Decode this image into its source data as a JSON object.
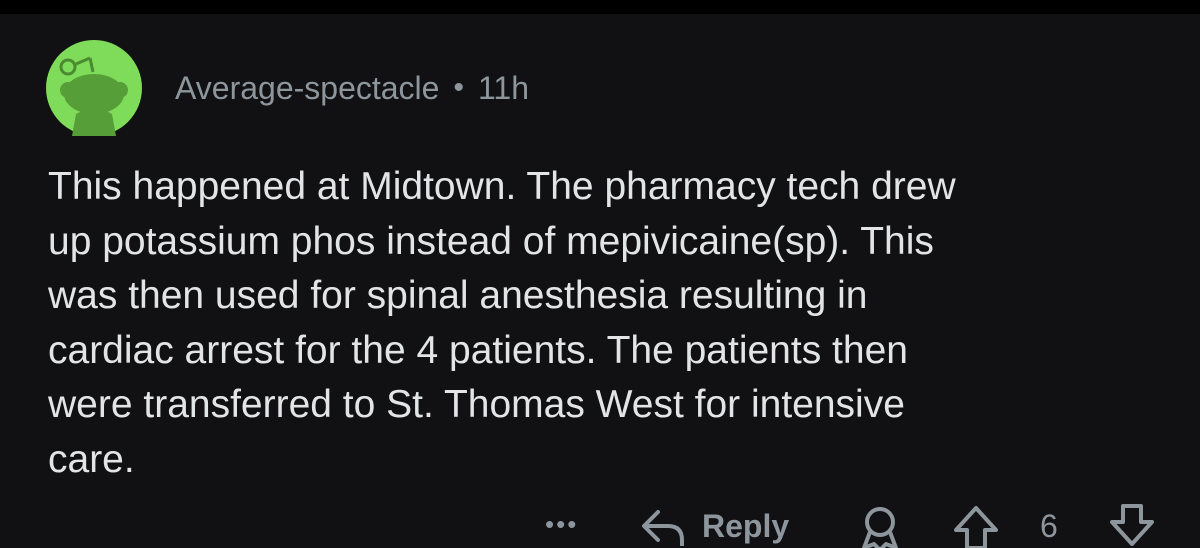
{
  "comment": {
    "author": "Average-spectacle",
    "separator": "•",
    "timestamp": "11h",
    "body": "This happened at Midtown. The pharmacy tech drew\nup potassium phos instead of mepivicaine(sp). This\nwas then used for spinal anesthesia resulting in\ncardiac arrest for the 4 patients. The patients then\nwere transferred to St. Thomas West for intensive\ncare.",
    "avatar_icon": "reddit-snoo-icon",
    "avatar_color": "#7fdc5a"
  },
  "actions": {
    "more_label": "•••",
    "reply_label": "Reply",
    "reply_icon": "reply-arrow-icon",
    "award_icon": "award-icon",
    "upvote_icon": "upvote-arrow-icon",
    "downvote_icon": "downvote-arrow-icon",
    "score": "6"
  },
  "colors": {
    "background": "#111113",
    "text": "#e2e4e6",
    "muted": "#8d969d"
  }
}
